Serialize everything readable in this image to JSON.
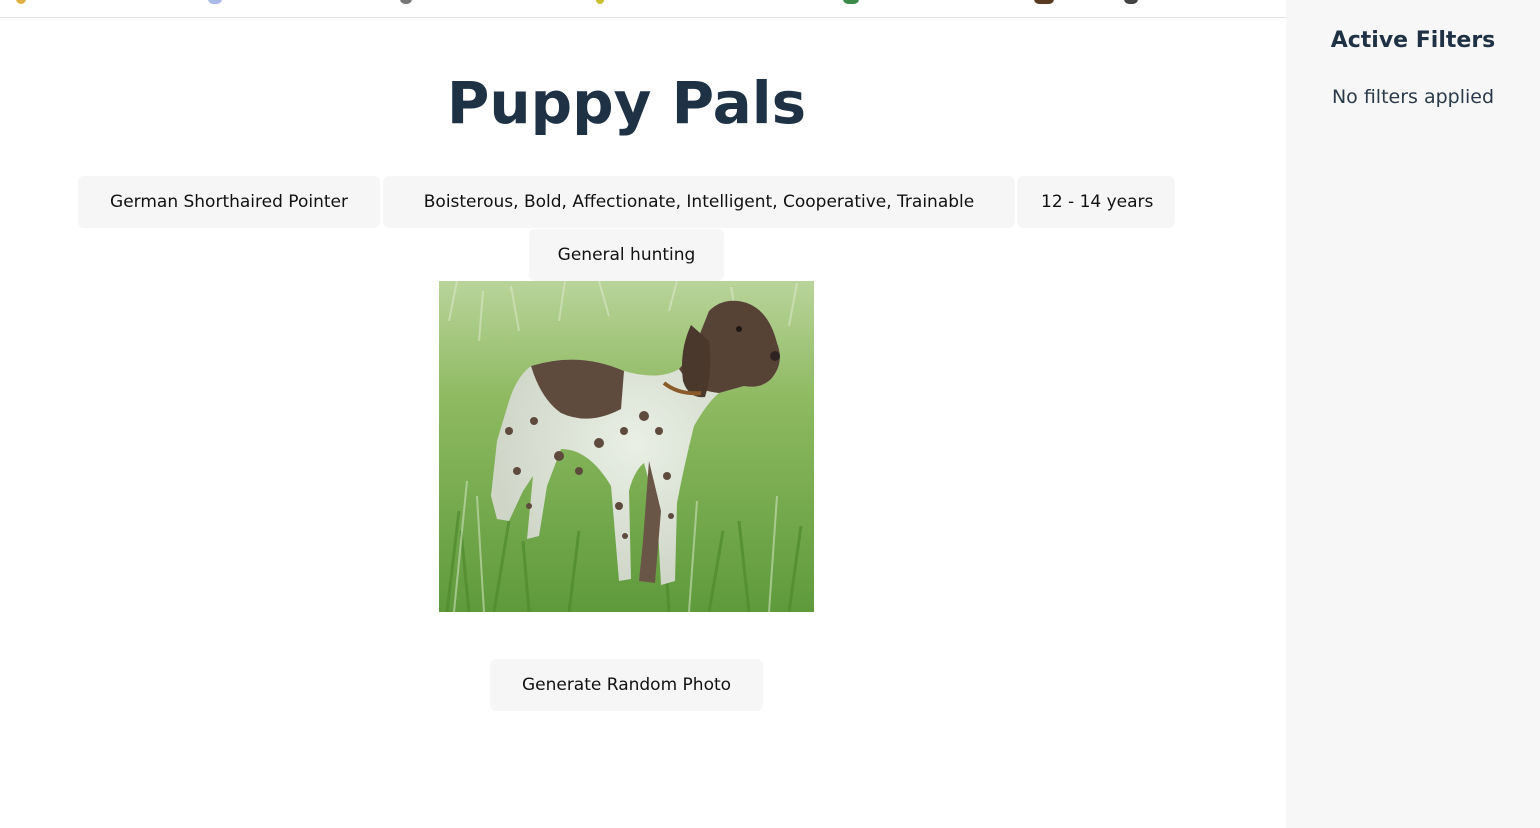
{
  "app": {
    "title": "Puppy Pals"
  },
  "dog": {
    "breed": "German Shorthaired Pointer",
    "temperament": "Boisterous, Bold, Affectionate, Intelligent, Cooperative, Trainable",
    "life_span": "12 - 14 years",
    "bred_for": "General hunting"
  },
  "actions": {
    "generate_label": "Generate Random Photo"
  },
  "sidebar": {
    "title": "Active Filters",
    "empty_text": "No filters applied"
  },
  "colors": {
    "title_text": "#1f3145",
    "chip_background": "#f6f6f6",
    "sidebar_background": "#f7f7f7"
  }
}
